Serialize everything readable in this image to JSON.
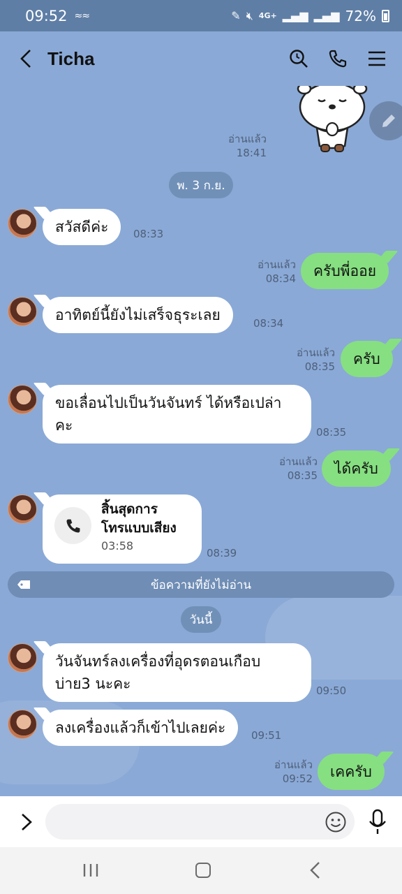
{
  "status_bar": {
    "time": "09:52",
    "battery": "72%",
    "network": "4G+"
  },
  "header": {
    "title": "Ticha",
    "icons": [
      "back-icon",
      "search-history-icon",
      "call-icon",
      "menu-icon"
    ]
  },
  "messages": [
    {
      "side": "out",
      "type": "sticker",
      "read": "อ่านแล้ว",
      "time": "18:41"
    },
    {
      "side": "in",
      "text": "สวัสดีค่ะ",
      "time": "08:33"
    },
    {
      "side": "out",
      "text": "ครับพี่ออย",
      "read": "อ่านแล้ว",
      "time": "08:34"
    },
    {
      "side": "in",
      "text": "อาทิตย์นี้ยังไม่เสร็จธุระเลย",
      "time": "08:34"
    },
    {
      "side": "out",
      "text": "ครับ",
      "read": "อ่านแล้ว",
      "time": "08:35"
    },
    {
      "side": "in",
      "text_lines": [
        "ขอเลื่อนไปเป็นวันจันทร์ ได้หรือเปล่า",
        "คะ"
      ],
      "time": "08:35"
    },
    {
      "side": "out",
      "text": "ได้ครับ",
      "read": "อ่านแล้ว",
      "time": "08:35"
    },
    {
      "side": "in",
      "type": "call",
      "title_lines": [
        "สิ้นสุดการ",
        "โทรแบบเสียง"
      ],
      "duration": "03:58",
      "time": "08:39"
    },
    {
      "side": "in",
      "text_lines": [
        "วันจันทร์ลงเครื่องที่อุดรตอนเกือบ",
        "บ่าย3 นะคะ"
      ],
      "time": "09:50"
    },
    {
      "side": "in",
      "text": "ลงเครื่องแล้วก็เข้าไปเลยค่ะ",
      "time": "09:51"
    },
    {
      "side": "out",
      "text": "เคครับ",
      "read": "อ่านแล้ว",
      "time": "09:52"
    }
  ],
  "date_separators": [
    "พ. 3 ก.ย.",
    "วันนี้"
  ],
  "unread_banner": "ข้อความที่ยังไม่อ่าน",
  "input": {
    "placeholder": "",
    "value": ""
  },
  "colors": {
    "chat_background": "#8aa9d6",
    "outgoing_bubble": "#86df81",
    "incoming_bubble": "#ffffff",
    "status_bar": "#5f7ea6"
  }
}
